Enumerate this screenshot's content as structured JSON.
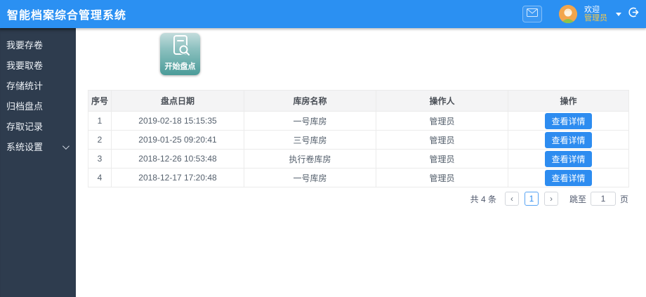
{
  "header": {
    "title": "智能档案综合管理系统",
    "welcome": "欢迎",
    "username": "管理员"
  },
  "sidebar": {
    "items": [
      {
        "label": "我要存卷"
      },
      {
        "label": "我要取卷"
      },
      {
        "label": "存储统计"
      },
      {
        "label": "归档盘点"
      },
      {
        "label": "存取记录"
      },
      {
        "label": "系统设置",
        "expandable": true
      }
    ]
  },
  "main": {
    "start_button": {
      "label": "开始盘点",
      "icon": "archive-search-icon"
    },
    "table": {
      "columns": [
        "序号",
        "盘点日期",
        "库房名称",
        "操作人",
        "操作"
      ],
      "rows": [
        {
          "no": "1",
          "date": "2019-02-18 15:15:35",
          "warehouse": "一号库房",
          "operator": "管理员",
          "action": "查看详情"
        },
        {
          "no": "2",
          "date": "2019-01-25 09:20:41",
          "warehouse": "三号库房",
          "operator": "管理员",
          "action": "查看详情"
        },
        {
          "no": "3",
          "date": "2018-12-26 10:53:48",
          "warehouse": "执行卷库房",
          "operator": "管理员",
          "action": "查看详情"
        },
        {
          "no": "4",
          "date": "2018-12-17 17:20:48",
          "warehouse": "一号库房",
          "operator": "管理员",
          "action": "查看详情"
        }
      ]
    },
    "pagination": {
      "total": "共 4 条",
      "prev": "‹",
      "page": "1",
      "next": "›",
      "jump_label": "跳至",
      "jump_value": "1",
      "jump_suffix": "页"
    }
  },
  "icons": {
    "mail": "envelope-icon",
    "avatar": "user-avatar",
    "caret": "chevron-down-icon",
    "logout": "logout-icon"
  },
  "colors": {
    "header_bg": "#2b90f2",
    "sidebar_bg": "#2e3c4e",
    "primary_button": "#2d8cf0",
    "start_button_top": "#c3dcdc",
    "start_button_bottom": "#4b9c99",
    "username_text": "#f5c84c",
    "table_header_bg": "#f4f4f5",
    "active_page_border": "#57a3f3"
  }
}
